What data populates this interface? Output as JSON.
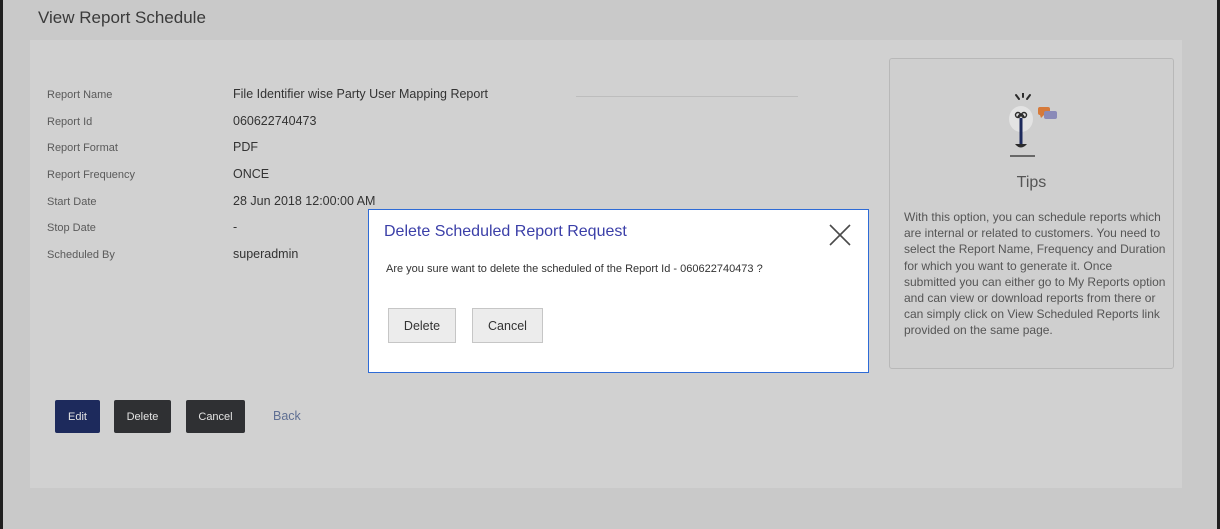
{
  "page": {
    "title": "View Report Schedule"
  },
  "details": [
    {
      "label": "Report Name",
      "value": "File Identifier wise Party User Mapping Report"
    },
    {
      "label": "Report Id",
      "value": "060622740473"
    },
    {
      "label": "Report Format",
      "value": "PDF"
    },
    {
      "label": "Report Frequency",
      "value": "ONCE"
    },
    {
      "label": "Start Date",
      "value": "28 Jun 2018 12:00:00 AM"
    },
    {
      "label": "Stop Date",
      "value": "-"
    },
    {
      "label": "Scheduled By",
      "value": "superadmin"
    }
  ],
  "actions": {
    "edit": "Edit",
    "delete": "Delete",
    "cancel": "Cancel",
    "back": "Back"
  },
  "tips": {
    "title": "Tips",
    "text": "With this option, you can schedule reports which are internal or related to customers. You need to select the Report Name, Frequency and Duration for which you want to generate it. Once submitted you can either go to My Reports option and can view or download reports from there or can simply click on View Scheduled Reports link provided on the same page."
  },
  "modal": {
    "title": "Delete Scheduled Report Request",
    "message": "Are you sure want to delete the scheduled of the Report Id - 060622740473 ?",
    "delete_label": "Delete",
    "cancel_label": "Cancel"
  },
  "colors": {
    "primary": "#1d2a5c",
    "dark_button": "#2f3033",
    "modal_title": "#3b3fa8",
    "modal_border": "#2e6bd6"
  },
  "icons": {
    "tips": "lightbulb-chat-icon",
    "close": "close-icon"
  }
}
